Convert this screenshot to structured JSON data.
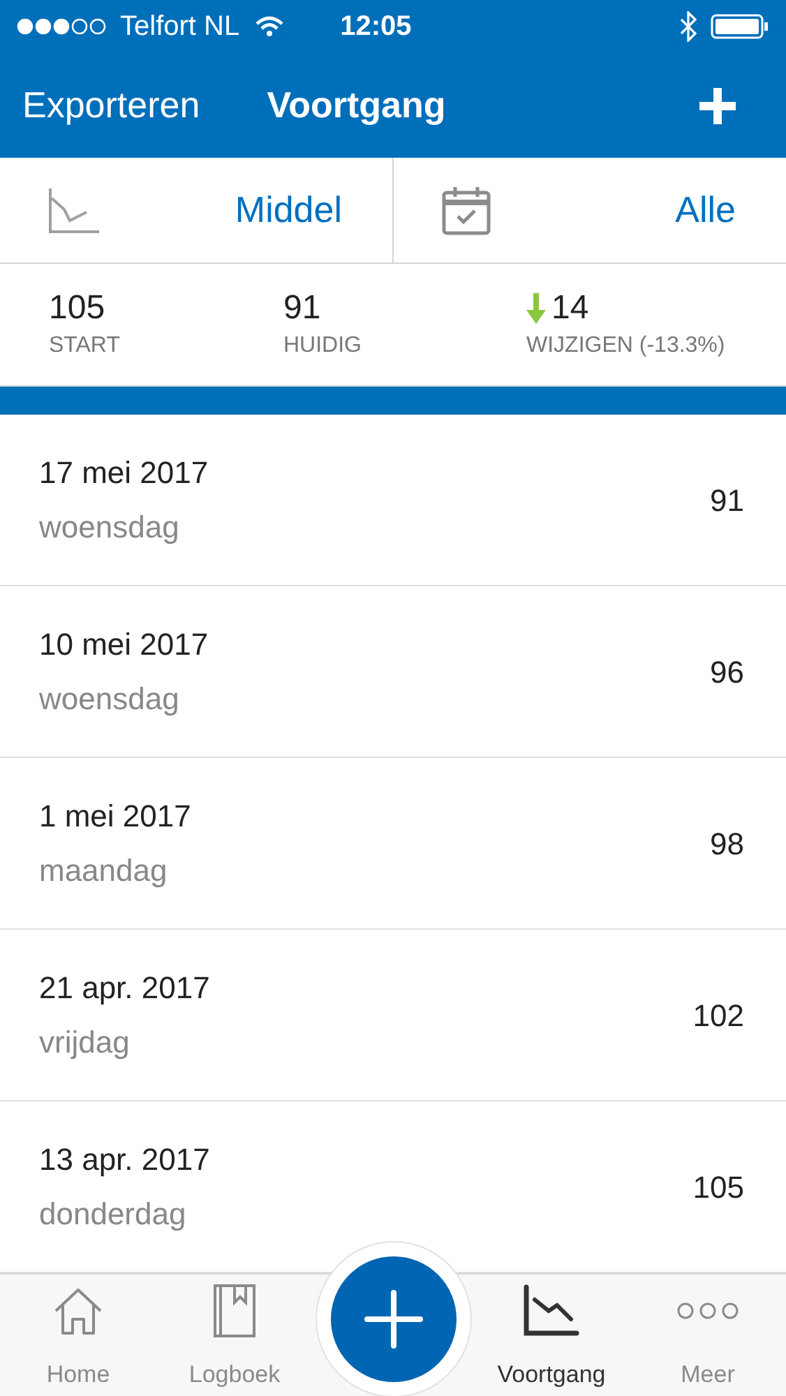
{
  "status_bar": {
    "carrier": "Telfort NL",
    "time": "12:05"
  },
  "nav_bar": {
    "left": "Exporteren",
    "title": "Voortgang"
  },
  "filters": [
    {
      "value": "Middel"
    },
    {
      "value": "Alle"
    }
  ],
  "stats": [
    {
      "kind": "plain",
      "value": "105",
      "label": "START"
    },
    {
      "kind": "plain",
      "value": "91",
      "label": "HUIDIG"
    },
    {
      "kind": "decrease",
      "value": "14",
      "label": "WIJZIGEN (-13.3%)"
    }
  ],
  "entries": [
    {
      "date": "17 mei 2017",
      "weekday": "woensdag",
      "value": "91"
    },
    {
      "date": "10 mei 2017",
      "weekday": "woensdag",
      "value": "96"
    },
    {
      "date": "1 mei 2017",
      "weekday": "maandag",
      "value": "98"
    },
    {
      "date": "21 apr. 2017",
      "weekday": "vrijdag",
      "value": "102"
    },
    {
      "date": "13 apr. 2017",
      "weekday": "donderdag",
      "value": "105"
    }
  ],
  "tab_bar": {
    "items": [
      {
        "label": "Home",
        "selected": false
      },
      {
        "label": "Logboek",
        "selected": false
      },
      {
        "label": "Voortgang",
        "selected": true
      },
      {
        "label": "Meer",
        "selected": false
      }
    ]
  }
}
